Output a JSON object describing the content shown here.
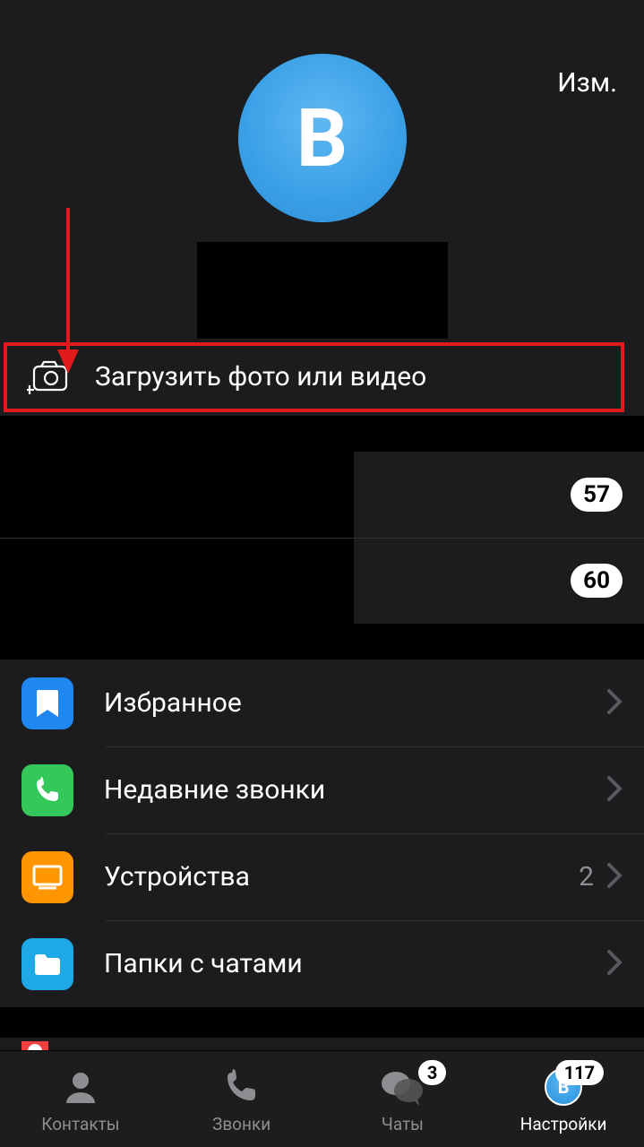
{
  "header": {
    "edit_label": "Изм.",
    "avatar_letter": "В"
  },
  "upload": {
    "label": "Загрузить фото или видео"
  },
  "info_rows": [
    {
      "badge": "57"
    },
    {
      "badge": "60"
    }
  ],
  "menu": [
    {
      "icon": "bookmark",
      "color": "#1e87f0",
      "label": "Избранное",
      "value": ""
    },
    {
      "icon": "phone",
      "color": "#34c759",
      "label": "Недавние звонки",
      "value": ""
    },
    {
      "icon": "monitor",
      "color": "#ff9500",
      "label": "Устройства",
      "value": "2"
    },
    {
      "icon": "folder",
      "color": "#1ea8e6",
      "label": "Папки с чатами",
      "value": ""
    }
  ],
  "tabs": {
    "contacts": {
      "label": "Контакты"
    },
    "calls": {
      "label": "Звонки"
    },
    "chats": {
      "label": "Чаты",
      "badge": "3"
    },
    "settings": {
      "label": "Настройки",
      "badge": "117",
      "avatar_letter": "В"
    }
  },
  "annotation": {
    "arrow_color": "#e11b1b"
  }
}
